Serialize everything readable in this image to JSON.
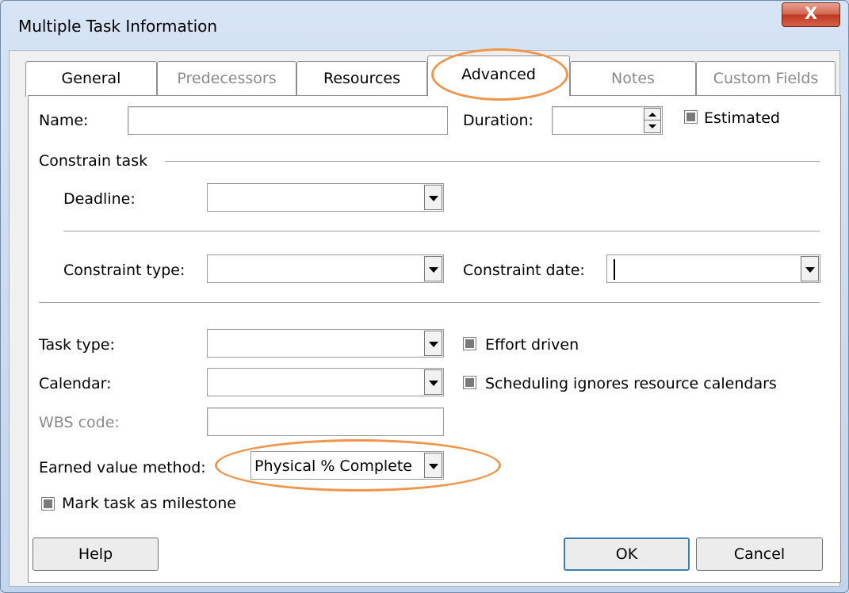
{
  "window": {
    "title": "Multiple Task Information",
    "close_glyph": "X"
  },
  "tabs": [
    {
      "label": "General",
      "state": "normal"
    },
    {
      "label": "Predecessors",
      "state": "disabled"
    },
    {
      "label": "Resources",
      "state": "normal"
    },
    {
      "label": "Advanced",
      "state": "active"
    },
    {
      "label": "Notes",
      "state": "disabled"
    },
    {
      "label": "Custom Fields",
      "state": "disabled"
    }
  ],
  "fields": {
    "name": {
      "label": "Name:",
      "value": ""
    },
    "duration": {
      "label": "Duration:",
      "value": ""
    },
    "estimated": {
      "label": "Estimated",
      "state": "indeterminate"
    },
    "constrain_group": "Constrain task",
    "deadline": {
      "label": "Deadline:",
      "value": ""
    },
    "constraint_type": {
      "label": "Constraint type:",
      "value": ""
    },
    "constraint_date": {
      "label": "Constraint date:",
      "value": ""
    },
    "task_type": {
      "label": "Task type:",
      "value": ""
    },
    "effort_driven": {
      "label": "Effort driven",
      "state": "indeterminate"
    },
    "calendar": {
      "label": "Calendar:",
      "value": ""
    },
    "scheduling_ignores": {
      "label": "Scheduling ignores resource calendars",
      "state": "indeterminate"
    },
    "wbs_code": {
      "label": "WBS code:",
      "value": ""
    },
    "earned_value": {
      "label": "Earned value method:",
      "value": "Physical % Complete"
    },
    "milestone": {
      "label": "Mark task as milestone",
      "state": "indeterminate"
    }
  },
  "buttons": {
    "help": "Help",
    "ok": "OK",
    "cancel": "Cancel"
  },
  "colors": {
    "highlight": "#f0954a",
    "panel": "#ffffff",
    "dialog": "#f0f0f0"
  }
}
